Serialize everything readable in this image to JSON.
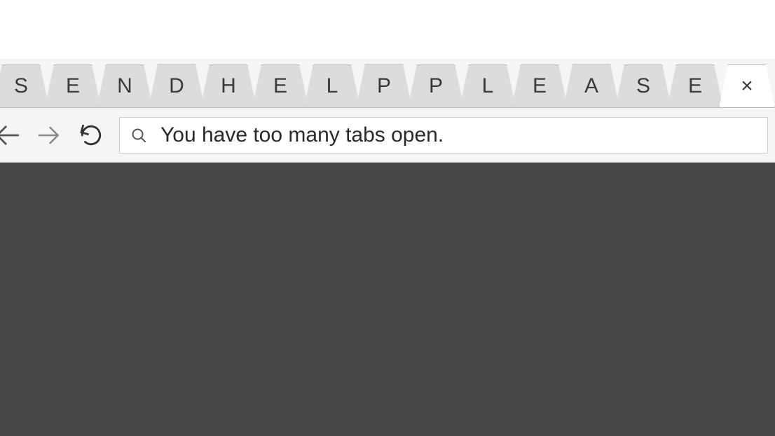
{
  "tabs": [
    {
      "label": "S",
      "active": false
    },
    {
      "label": "E",
      "active": false
    },
    {
      "label": "N",
      "active": false
    },
    {
      "label": "D",
      "active": false
    },
    {
      "label": "H",
      "active": false
    },
    {
      "label": "E",
      "active": false
    },
    {
      "label": "L",
      "active": false
    },
    {
      "label": "P",
      "active": false
    },
    {
      "label": "P",
      "active": false
    },
    {
      "label": "L",
      "active": false
    },
    {
      "label": "E",
      "active": false
    },
    {
      "label": "A",
      "active": false
    },
    {
      "label": "S",
      "active": false
    },
    {
      "label": "E",
      "active": false
    },
    {
      "label": "×",
      "active": true
    }
  ],
  "address": {
    "text": "You have too many tabs open."
  }
}
